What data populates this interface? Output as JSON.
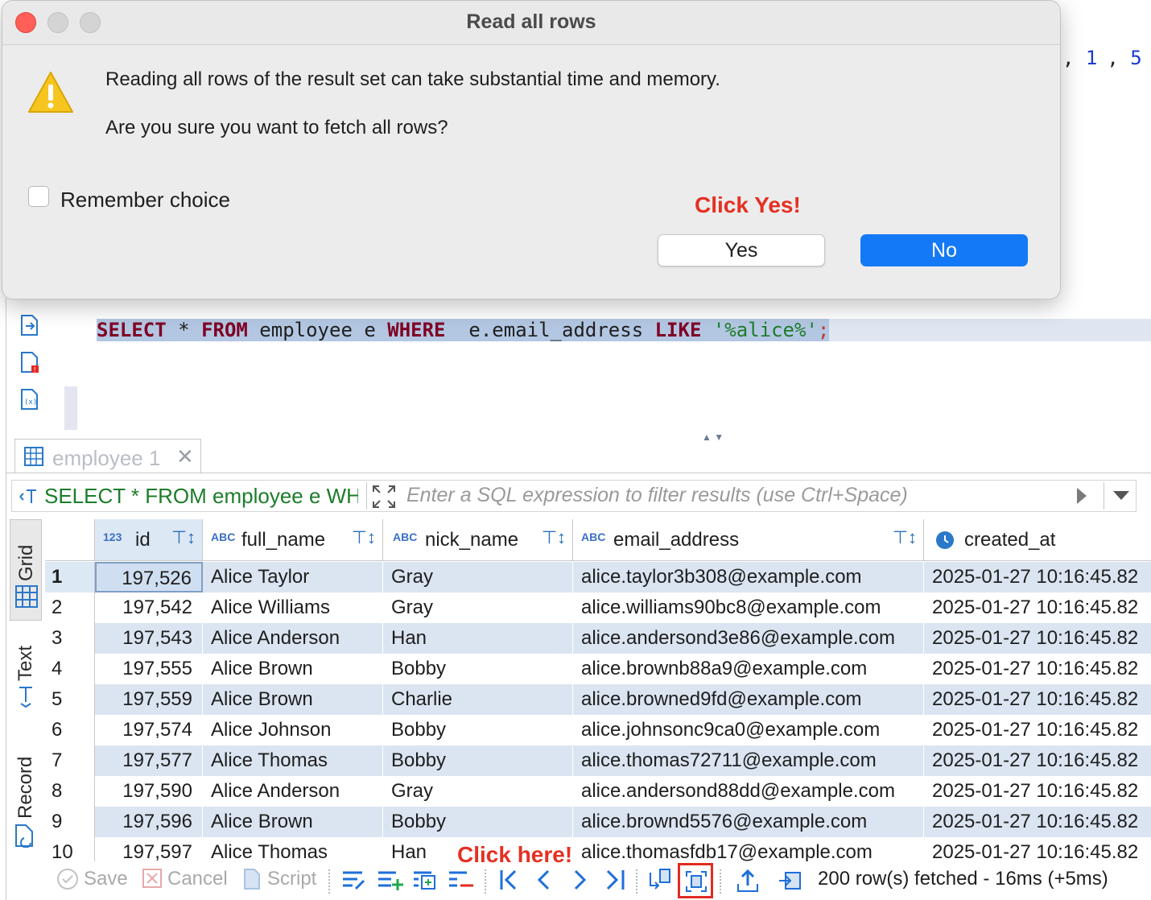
{
  "background_code": {
    "comma": ", ",
    "n1": "1",
    "sep": ", ",
    "n2": "5",
    "close": ")"
  },
  "editor": {
    "sql": {
      "select": "SELECT",
      "star": " * ",
      "from": "FROM",
      "table": " employee e ",
      "where": "WHERE",
      "col": "  e.email_address ",
      "like": "LIKE",
      "sp": " ",
      "str": "'%alice%'",
      "semi": ";"
    }
  },
  "results": {
    "tab_label": "employee 1",
    "tab_close": "✕",
    "filter_query": "SELECT * FROM employee e WHERE e.email_address LIKE '%alice%'",
    "filter_placeholder": "Enter a SQL expression to filter results (use Ctrl+Space)",
    "view_tabs": {
      "grid": "Grid",
      "text": "Text",
      "record": "Record"
    },
    "columns": [
      {
        "name": "id",
        "type_icon": "123"
      },
      {
        "name": "full_name",
        "type_icon": "ABC"
      },
      {
        "name": "nick_name",
        "type_icon": "ABC"
      },
      {
        "name": "email_address",
        "type_icon": "ABC"
      },
      {
        "name": "created_at",
        "type_icon": "clock"
      }
    ],
    "rows": [
      {
        "n": "1",
        "id": "197,526",
        "full_name": "Alice Taylor",
        "nick_name": "Gray",
        "email": "alice.taylor3b308@example.com",
        "created_at": "2025-01-27 10:16:45.82"
      },
      {
        "n": "2",
        "id": "197,542",
        "full_name": "Alice Williams",
        "nick_name": "Gray",
        "email": "alice.williams90bc8@example.com",
        "created_at": "2025-01-27 10:16:45.82"
      },
      {
        "n": "3",
        "id": "197,543",
        "full_name": "Alice Anderson",
        "nick_name": "Han",
        "email": "alice.andersond3e86@example.com",
        "created_at": "2025-01-27 10:16:45.82"
      },
      {
        "n": "4",
        "id": "197,555",
        "full_name": "Alice Brown",
        "nick_name": "Bobby",
        "email": "alice.brownb88a9@example.com",
        "created_at": "2025-01-27 10:16:45.82"
      },
      {
        "n": "5",
        "id": "197,559",
        "full_name": "Alice Brown",
        "nick_name": "Charlie",
        "email": "alice.browned9fd@example.com",
        "created_at": "2025-01-27 10:16:45.82"
      },
      {
        "n": "6",
        "id": "197,574",
        "full_name": "Alice Johnson",
        "nick_name": "Bobby",
        "email": "alice.johnsonc9ca0@example.com",
        "created_at": "2025-01-27 10:16:45.82"
      },
      {
        "n": "7",
        "id": "197,577",
        "full_name": "Alice Thomas",
        "nick_name": "Bobby",
        "email": "alice.thomas72711@example.com",
        "created_at": "2025-01-27 10:16:45.82"
      },
      {
        "n": "8",
        "id": "197,590",
        "full_name": "Alice Anderson",
        "nick_name": "Gray",
        "email": "alice.andersond88dd@example.com",
        "created_at": "2025-01-27 10:16:45.82"
      },
      {
        "n": "9",
        "id": "197,596",
        "full_name": "Alice Brown",
        "nick_name": "Bobby",
        "email": "alice.brownd5576@example.com",
        "created_at": "2025-01-27 10:16:45.82"
      },
      {
        "n": "10",
        "id": "197,597",
        "full_name": "Alice Thomas",
        "nick_name": "Han",
        "email": "alice.thomasfdb17@example.com",
        "created_at": "2025-01-27 10:16:45.82"
      }
    ]
  },
  "toolbar": {
    "save": "Save",
    "cancel": "Cancel",
    "script": "Script",
    "status": "200 row(s) fetched - 16ms (+5ms)"
  },
  "annotations": {
    "click_yes": "Click Yes!",
    "click_here": "Click here!"
  },
  "dialog": {
    "title": "Read all rows",
    "message1": "Reading all rows of the result set can take substantial time and memory.",
    "message2": "Are you sure you want to fetch all rows?",
    "remember_label": "Remember choice",
    "yes_label": "Yes",
    "no_label": "No"
  },
  "colors": {
    "accent_blue": "#1479f6",
    "annotation_red": "#e53022",
    "row_alt": "#dbe5f1",
    "keyword": "#7f0024"
  }
}
